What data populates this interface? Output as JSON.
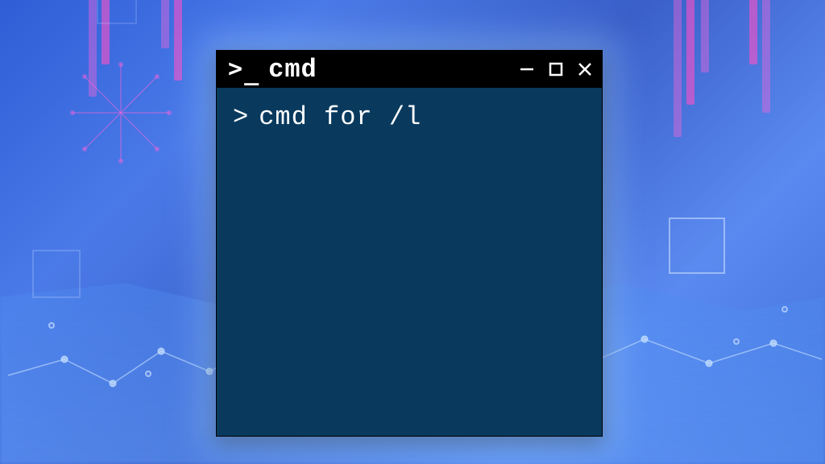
{
  "window": {
    "title": "cmd",
    "icon_label": ">_"
  },
  "terminal": {
    "prompt": ">",
    "command": "cmd for /l"
  }
}
